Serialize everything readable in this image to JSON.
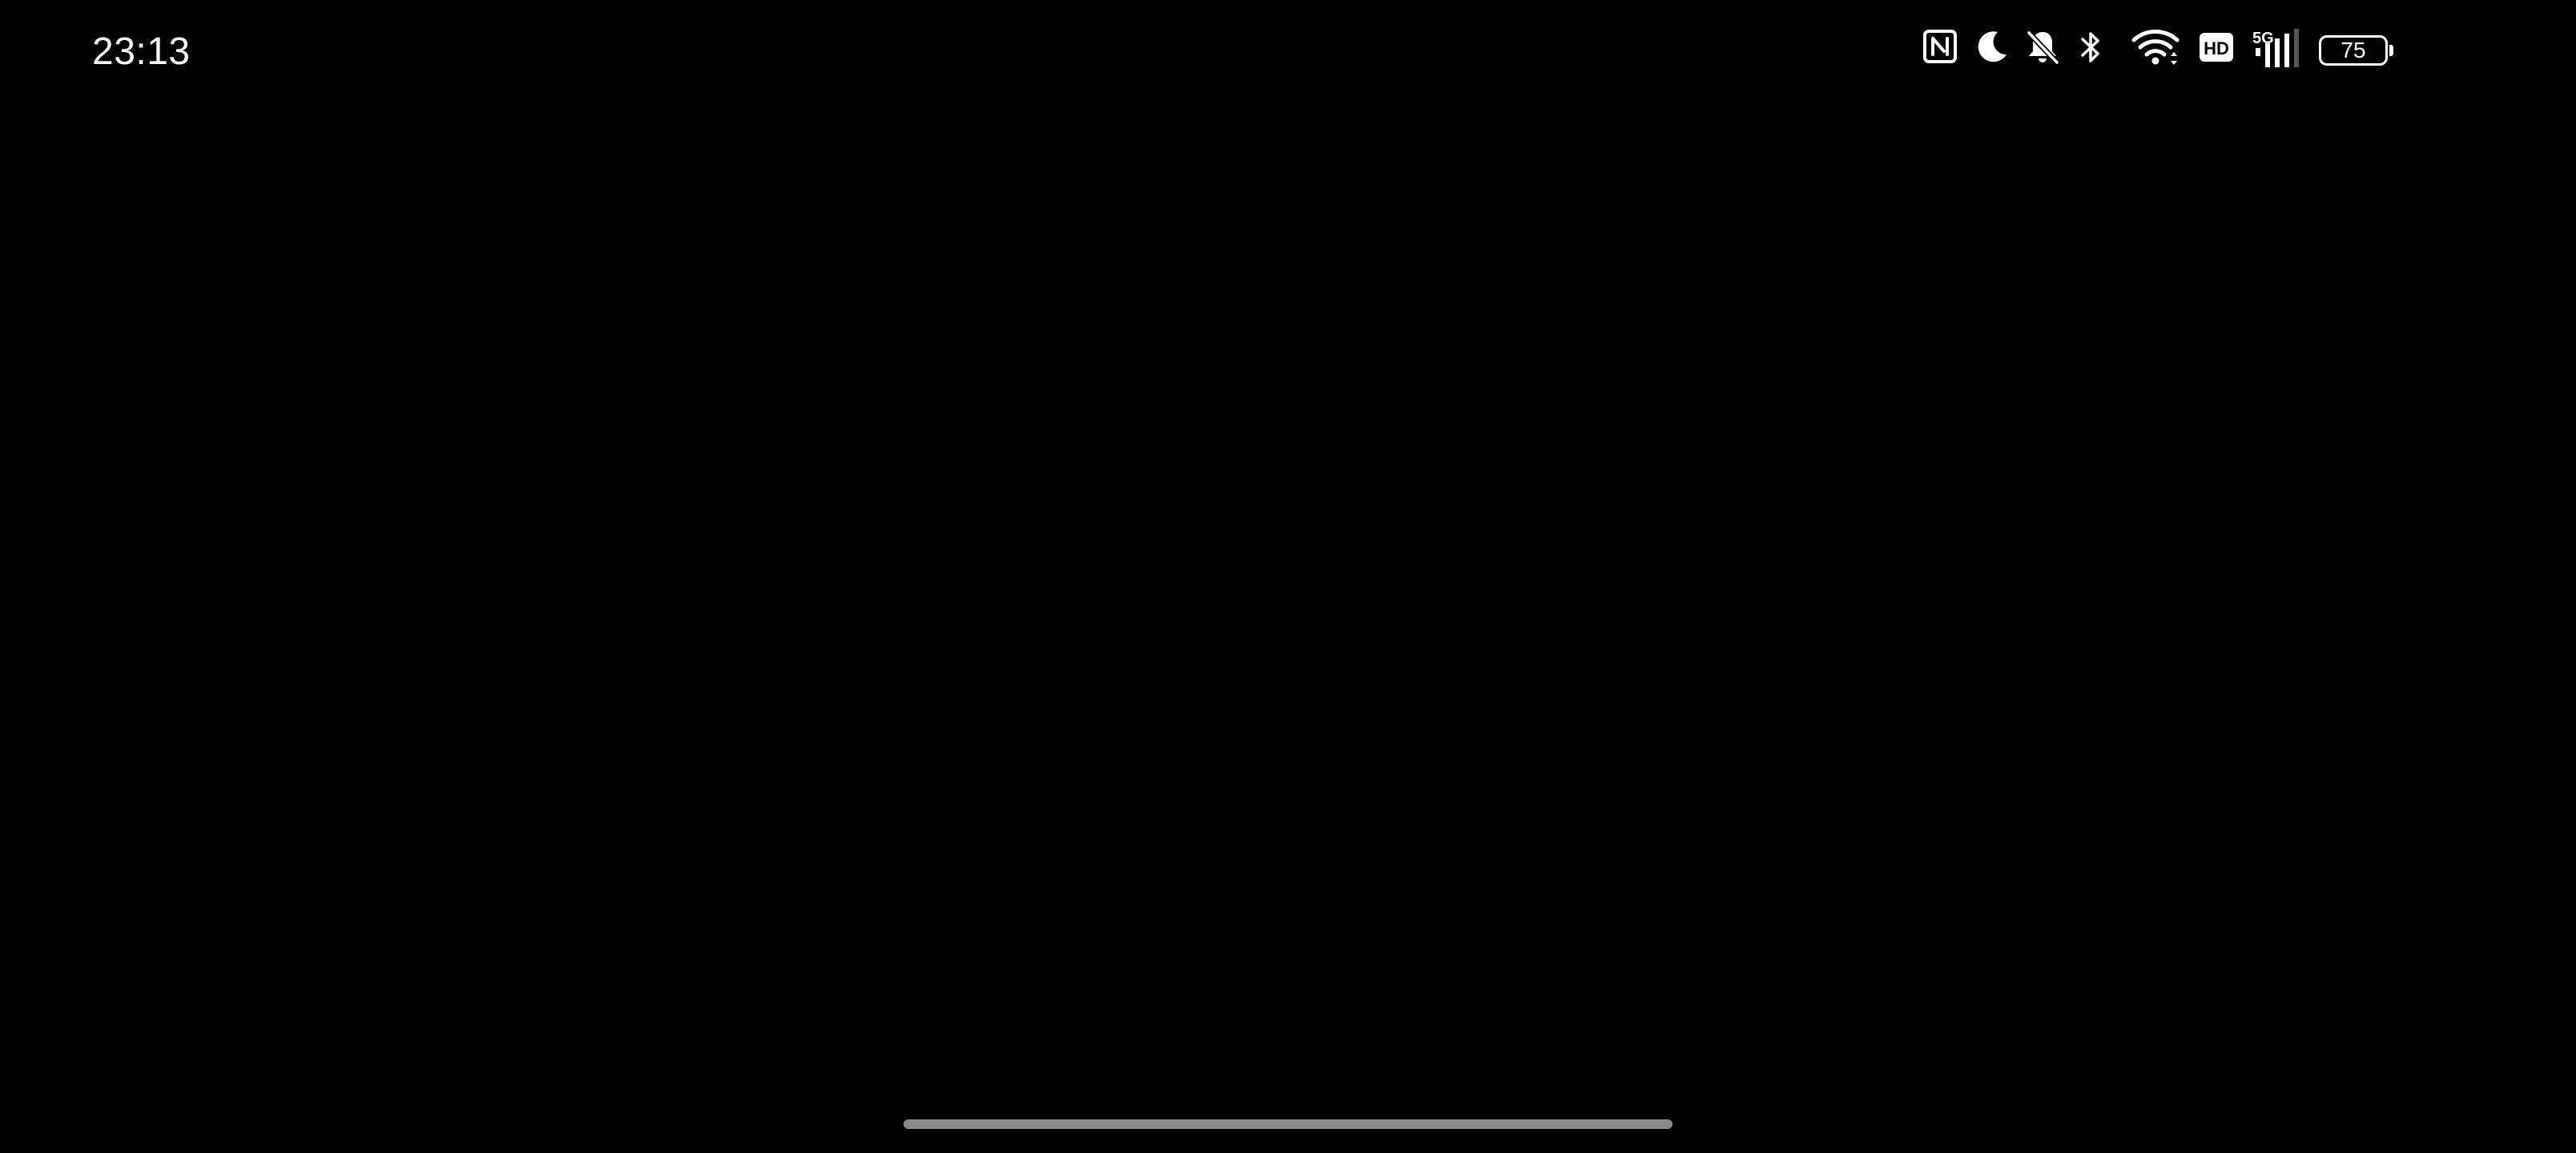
{
  "status_bar": {
    "time": "23:13",
    "icons": [
      "nfc-icon",
      "do-not-disturb-moon-icon",
      "bell-off-icon",
      "bluetooth-icon",
      "wifi-icon",
      "hd-icon",
      "5g-signal-icon"
    ],
    "network_label": "5G",
    "hd_label": "HD",
    "battery_level": "75"
  },
  "colors": {
    "background": "#000000",
    "foreground": "#ffffff",
    "home_indicator": "#8a8a8a"
  }
}
